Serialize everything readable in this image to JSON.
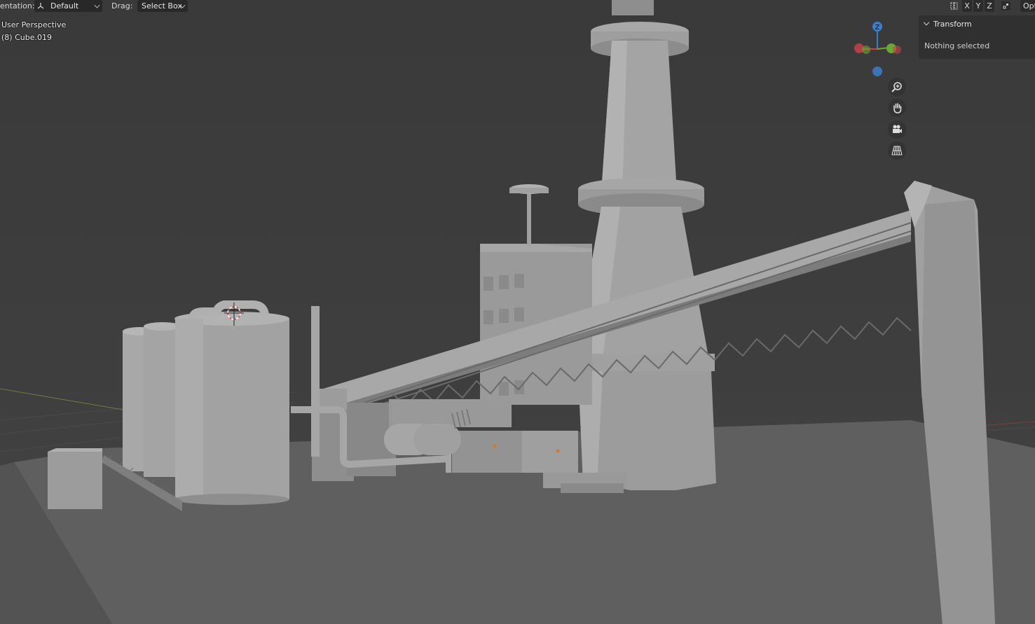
{
  "header": {
    "orientation_label": "entation:",
    "orientation_value": "Default",
    "drag_label": "Drag:",
    "drag_value": "Select Box",
    "axis_buttons": [
      "X",
      "Y",
      "Z"
    ],
    "options_label": "Opt"
  },
  "viewport": {
    "view_name": "User Perspective",
    "active_object": "(8) Cube.019"
  },
  "gizmo": {
    "z_label": "Z",
    "x_color": "#c8414b",
    "y_color": "#6aa834",
    "z_color": "#3d7ec9"
  },
  "nav_icons": [
    "zoom-icon",
    "hand-pan-icon",
    "camera-icon",
    "grid-view-icon"
  ],
  "sidebar": {
    "panel_title": "Transform",
    "panel_body": "Nothing selected"
  }
}
